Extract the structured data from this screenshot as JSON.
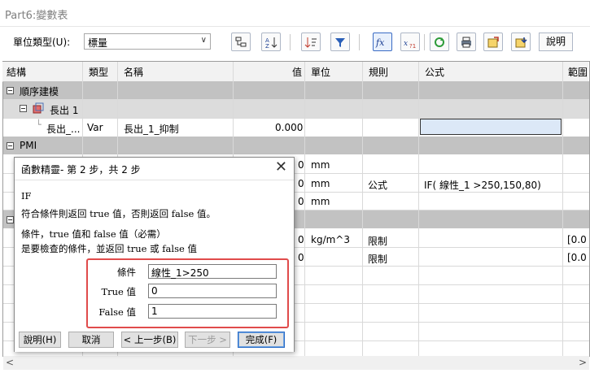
{
  "window": {
    "title": "Part6:變數表"
  },
  "toolbar": {
    "unit_type_label": "單位類型(U):",
    "unit_type_value": "標量",
    "help_label": "說明"
  },
  "grid": {
    "columns": [
      "結構",
      "類型",
      "名稱",
      "值",
      "單位",
      "規則",
      "公式",
      "範圍"
    ],
    "group1": {
      "label": "順序建模"
    },
    "feature": {
      "label": "長出 1"
    },
    "row_extrude": {
      "struct": "長出_...",
      "type": "Var",
      "name": "長出_1_抑制",
      "value": "0.000"
    },
    "group2": {
      "label": "PMI"
    },
    "row_a": {
      "value": "0",
      "unit": "mm"
    },
    "row_b": {
      "value": "0",
      "unit": "mm",
      "rule": "公式",
      "formula": "IF( 線性_1 >250,150,80)"
    },
    "row_c": {
      "value": "0",
      "unit": "mm"
    },
    "row_d": {
      "value": "0",
      "unit": "kg/m^3",
      "rule": "限制",
      "range": "[0.0"
    },
    "row_e": {
      "value": "0",
      "rule": "限制",
      "range": "[0.0"
    }
  },
  "dialog": {
    "title": "函數精靈- 第 2 步，共 2 步",
    "func_name": "IF",
    "description": "符合條件則返回 true 值，否則返回 false 值。",
    "param_line1": "條件，true 值和 false 值（必需）",
    "param_line2": "是要檢查的條件，並返回 true 或 false 值",
    "fields": {
      "condition_label": "條件",
      "condition_value": "線性_1>250",
      "true_label": "True 值",
      "true_value": "0",
      "false_label": "False 值",
      "false_value": "1"
    },
    "buttons": {
      "help": "說明(H)",
      "cancel": "取消",
      "back": "< 上一步(B)",
      "next": "下一步 >",
      "finish": "完成(F)"
    }
  }
}
